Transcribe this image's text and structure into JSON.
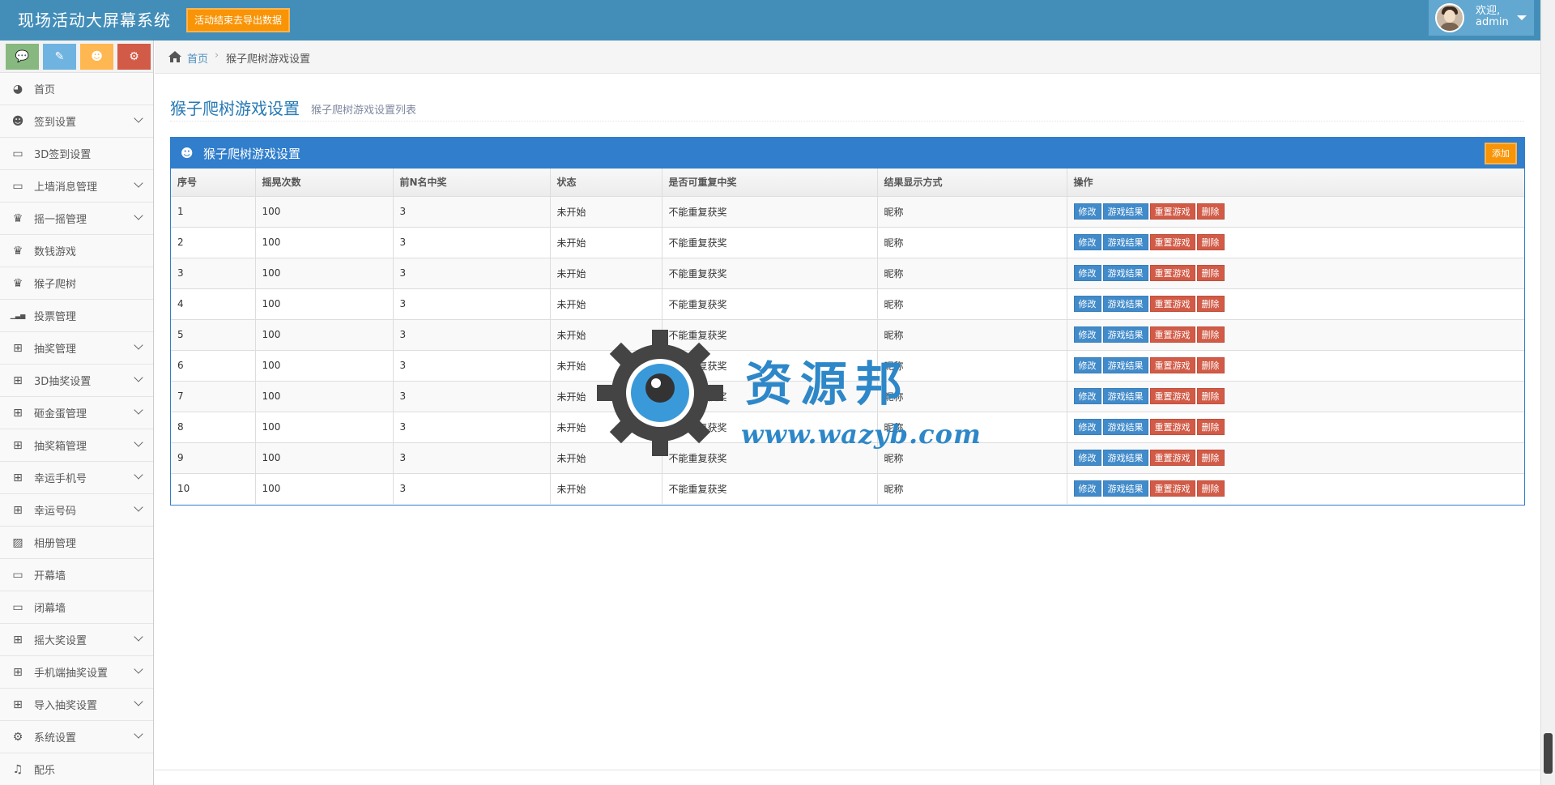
{
  "navbar": {
    "brand": "现场活动大屏幕系统",
    "clear_button": "活动结束去导出数据",
    "user_greeting": "欢迎,",
    "user_name": "admin"
  },
  "shortcuts": [
    {
      "icon": "comment-icon",
      "glyph": "💬",
      "color": "#87b87f"
    },
    {
      "icon": "pencil-icon",
      "glyph": "✎",
      "color": "#6fb3e0"
    },
    {
      "icon": "users-icon",
      "glyph": "☻",
      "color": "#ffb752"
    },
    {
      "icon": "cogs-icon",
      "glyph": "⚙",
      "color": "#d15b47"
    }
  ],
  "sidebar": {
    "items": [
      {
        "label": "首页",
        "icon": "dashboard-icon",
        "glyph": "◕",
        "has_submenu": false
      },
      {
        "label": "签到设置",
        "icon": "users-icon",
        "glyph": "☻",
        "has_submenu": true
      },
      {
        "label": "3D签到设置",
        "icon": "desktop-icon",
        "glyph": "▭",
        "has_submenu": false
      },
      {
        "label": "上墙消息管理",
        "icon": "desktop-icon",
        "glyph": "▭",
        "has_submenu": true
      },
      {
        "label": "摇一摇管理",
        "icon": "trophy-icon",
        "glyph": "♛",
        "has_submenu": true
      },
      {
        "label": "数钱游戏",
        "icon": "trophy-icon",
        "glyph": "♛",
        "has_submenu": false
      },
      {
        "label": "猴子爬树",
        "icon": "trophy-icon",
        "glyph": "♛",
        "has_submenu": false
      },
      {
        "label": "投票管理",
        "icon": "signal-icon",
        "glyph": "▁▃▅",
        "has_submenu": false
      },
      {
        "label": "抽奖管理",
        "icon": "gift-icon",
        "glyph": "⊞",
        "has_submenu": true
      },
      {
        "label": "3D抽奖设置",
        "icon": "gift-icon",
        "glyph": "⊞",
        "has_submenu": true
      },
      {
        "label": "砸金蛋管理",
        "icon": "gift-icon",
        "glyph": "⊞",
        "has_submenu": true
      },
      {
        "label": "抽奖箱管理",
        "icon": "gift-icon",
        "glyph": "⊞",
        "has_submenu": true
      },
      {
        "label": "幸运手机号",
        "icon": "gift-icon",
        "glyph": "⊞",
        "has_submenu": true
      },
      {
        "label": "幸运号码",
        "icon": "gift-icon",
        "glyph": "⊞",
        "has_submenu": true
      },
      {
        "label": "相册管理",
        "icon": "picture-icon",
        "glyph": "▨",
        "has_submenu": false
      },
      {
        "label": "开幕墙",
        "icon": "desktop-icon",
        "glyph": "▭",
        "has_submenu": false
      },
      {
        "label": "闭幕墙",
        "icon": "desktop-icon",
        "glyph": "▭",
        "has_submenu": false
      },
      {
        "label": "摇大奖设置",
        "icon": "gift-icon",
        "glyph": "⊞",
        "has_submenu": true
      },
      {
        "label": "手机端抽奖设置",
        "icon": "gift-icon",
        "glyph": "⊞",
        "has_submenu": true
      },
      {
        "label": "导入抽奖设置",
        "icon": "gift-icon",
        "glyph": "⊞",
        "has_submenu": true
      },
      {
        "label": "系统设置",
        "icon": "cog-icon",
        "glyph": "⚙",
        "has_submenu": true
      },
      {
        "label": "配乐",
        "icon": "music-icon",
        "glyph": "♫",
        "has_submenu": false
      }
    ]
  },
  "breadcrumb": {
    "home": "首页",
    "current": "猴子爬树游戏设置"
  },
  "page": {
    "title": "猴子爬树游戏设置",
    "subtitle": "猴子爬树游戏设置列表"
  },
  "panel": {
    "title": "猴子爬树游戏设置",
    "add_button": "添加"
  },
  "table": {
    "columns": [
      "序号",
      "摇晃次数",
      "前N名中奖",
      "状态",
      "是否可重复中奖",
      "结果显示方式",
      "操作"
    ],
    "actions": [
      {
        "label": "修改",
        "style": "blue"
      },
      {
        "label": "游戏结果",
        "style": "blue"
      },
      {
        "label": "重置游戏",
        "style": "red"
      },
      {
        "label": "删除",
        "style": "red"
      }
    ],
    "rows": [
      [
        "1",
        "100",
        "3",
        "未开始",
        "不能重复获奖",
        "昵称"
      ],
      [
        "2",
        "100",
        "3",
        "未开始",
        "不能重复获奖",
        "昵称"
      ],
      [
        "3",
        "100",
        "3",
        "未开始",
        "不能重复获奖",
        "昵称"
      ],
      [
        "4",
        "100",
        "3",
        "未开始",
        "不能重复获奖",
        "昵称"
      ],
      [
        "5",
        "100",
        "3",
        "未开始",
        "不能重复获奖",
        "昵称"
      ],
      [
        "6",
        "100",
        "3",
        "未开始",
        "不能重复获奖",
        "昵称"
      ],
      [
        "7",
        "100",
        "3",
        "未开始",
        "不能重复获奖",
        "昵称"
      ],
      [
        "8",
        "100",
        "3",
        "未开始",
        "不能重复获奖",
        "昵称"
      ],
      [
        "9",
        "100",
        "3",
        "未开始",
        "不能重复获奖",
        "昵称"
      ],
      [
        "10",
        "100",
        "3",
        "未开始",
        "不能重复获奖",
        "昵称"
      ]
    ]
  },
  "watermark": {
    "title": "资源邦",
    "url": "www.wazyb.com"
  },
  "colors": {
    "navbar": "#438eb9",
    "panel_header": "#307ecc",
    "btn_blue": "#428bca",
    "btn_red": "#d15b47",
    "btn_orange": "#f89406"
  }
}
